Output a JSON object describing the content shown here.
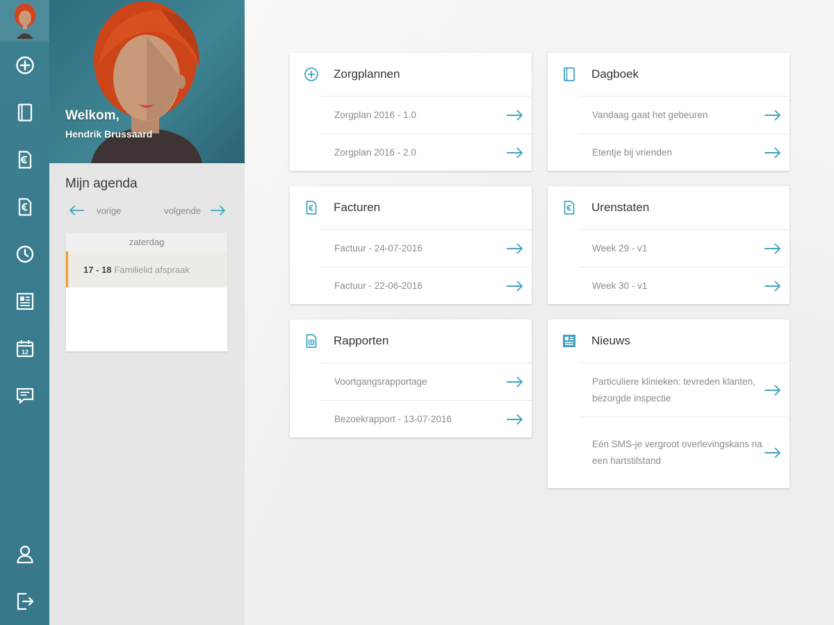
{
  "colors": {
    "accent": "#3fa3bf",
    "rail": "#3a7c8e",
    "event_marker": "#f0a020"
  },
  "profile": {
    "welcome": "Welkom,",
    "name": "Hendrik Brussaard"
  },
  "rail": {
    "items": [
      {
        "icon": "add-circle-icon"
      },
      {
        "icon": "journal-icon"
      },
      {
        "icon": "invoice-document-icon"
      },
      {
        "icon": "euro-document-icon"
      },
      {
        "icon": "clock-icon"
      },
      {
        "icon": "newspaper-icon"
      },
      {
        "icon": "calendar-icon",
        "text": "12"
      },
      {
        "icon": "chat-icon"
      }
    ],
    "bottom": [
      {
        "icon": "user-icon"
      },
      {
        "icon": "logout-icon"
      }
    ]
  },
  "agenda": {
    "title": "Mijn agenda",
    "prev_label": "vorige",
    "next_label": "volgende",
    "day": "zaterdag",
    "events": [
      {
        "time": "17 - 18",
        "title": "Familielid afspraak"
      }
    ]
  },
  "cards": {
    "zorgplannen": {
      "title": "Zorgplannen",
      "icon": "add-circle-icon",
      "items": [
        "Zorgplan 2016 - 1.0",
        "Zorgplan 2016 - 2.0"
      ]
    },
    "dagboek": {
      "title": "Dagboek",
      "icon": "journal-icon",
      "items": [
        "Vandaag gaat het gebeuren",
        "Etentje bij vrienden"
      ]
    },
    "facturen": {
      "title": "Facturen",
      "icon": "invoice-document-icon",
      "items": [
        "Factuur - 24-07-2016",
        "Factuur - 22-06-2016"
      ]
    },
    "urenstaten": {
      "title": "Urenstaten",
      "icon": "timesheet-document-icon",
      "items": [
        "Week 29 - v1",
        "Week 30 - v1"
      ]
    },
    "rapporten": {
      "title": "Rapporten",
      "icon": "report-document-icon",
      "items": [
        "Voortgangsrapportage",
        "Bezoekrapport - 13-07-2016"
      ]
    },
    "nieuws": {
      "title": "Nieuws",
      "icon": "newspaper-icon",
      "items": [
        "Particuliere klinieken: tevreden klanten, bezorgde inspectie",
        "Eén SMS-je vergroot overlevingskans na een hartstilstand"
      ]
    }
  }
}
